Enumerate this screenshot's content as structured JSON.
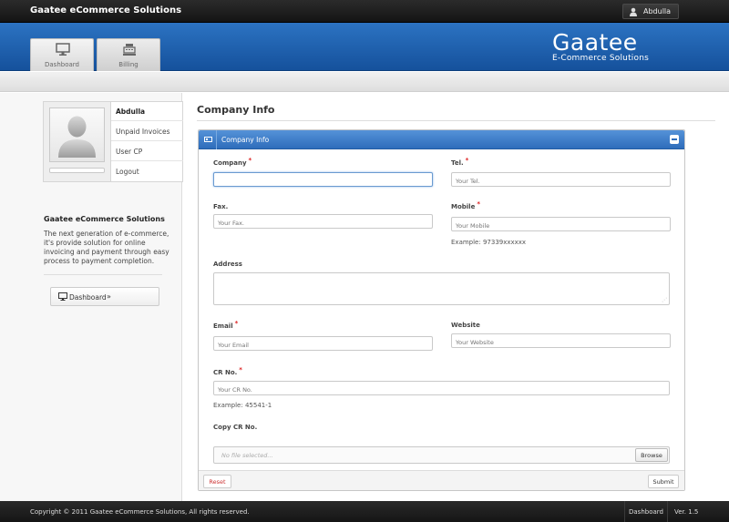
{
  "app": {
    "title": "Gaatee eCommerce Solutions",
    "user_name": "Abdulla"
  },
  "nav": {
    "tabs": [
      {
        "label": "Dashboard",
        "icon": "monitor-icon"
      },
      {
        "label": "Billing",
        "icon": "cash-register-icon"
      }
    ]
  },
  "logo": {
    "name": "Gaatee",
    "tagline": "E-Commerce Solutions"
  },
  "sidebar": {
    "profile_name": "Abdulla",
    "links": [
      "Unpaid Invoices",
      "User CP",
      "Logout"
    ],
    "about_title": "Gaatee eCommerce Solutions",
    "about_text": "The next generation of e-commerce, it's provide solution for online invoicing and payment through easy process to payment completion.",
    "dashboard_link": "Dashboard",
    "dashboard_chevron": "»"
  },
  "page": {
    "title": "Company Info"
  },
  "panel": {
    "title": "Company Info",
    "fields": {
      "company": {
        "label": "Company",
        "placeholder": "",
        "required": true
      },
      "tel": {
        "label": "Tel.",
        "placeholder": "Your Tel.",
        "required": true
      },
      "fax": {
        "label": "Fax.",
        "placeholder": "Your Fax.",
        "required": false
      },
      "mobile": {
        "label": "Mobile",
        "placeholder": "Your Mobile",
        "required": true,
        "hint": "Example: 97339xxxxxx"
      },
      "address": {
        "label": "Address",
        "required": false
      },
      "email": {
        "label": "Email",
        "placeholder": "Your Email",
        "required": true
      },
      "website": {
        "label": "Website",
        "placeholder": "Your Website",
        "required": false
      },
      "cr_no": {
        "label": "CR No.",
        "placeholder": "Your CR No.",
        "required": true,
        "hint": "Example: 45541-1"
      },
      "copy_cr": {
        "label": "Copy CR No.",
        "file_placeholder": "No file selected...",
        "browse_label": "Browse"
      }
    },
    "reset_label": "Reset",
    "submit_label": "Submit",
    "required_marker": "*"
  },
  "footer": {
    "copyright": "Copyright © 2011 Gaatee eCommerce Solutions, All rights reserved.",
    "dashboard_link": "Dashboard",
    "version": "Ver. 1.5"
  },
  "colors": {
    "banner": "#1f62b0",
    "panel_header": "#3f7ec8",
    "required": "#dd2222",
    "topbar": "#1e1e1e"
  }
}
